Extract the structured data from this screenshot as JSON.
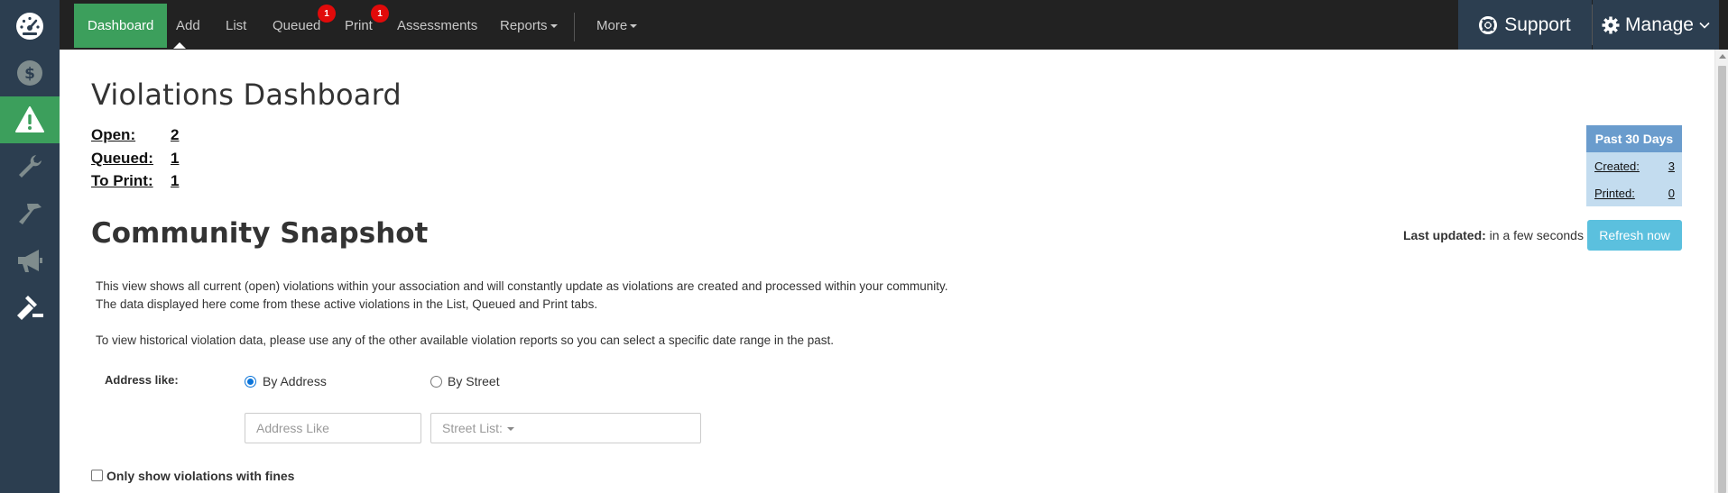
{
  "sidebar": {
    "items": [
      {
        "icon": "speedometer-icon",
        "active": false
      },
      {
        "icon": "dollar-icon",
        "active": false
      },
      {
        "icon": "warning-icon",
        "active": true
      },
      {
        "icon": "wrench-icon",
        "active": false
      },
      {
        "icon": "hammer-icon",
        "active": false
      },
      {
        "icon": "megaphone-icon",
        "active": false
      },
      {
        "icon": "gavel-icon",
        "active": false
      }
    ]
  },
  "topnav": {
    "dashboard": "Dashboard",
    "add": "Add",
    "list": "List",
    "queued": "Queued",
    "queued_badge": "1",
    "print": "Print",
    "print_badge": "1",
    "assessments": "Assessments",
    "reports": "Reports",
    "more": "More",
    "support": "Support",
    "manage": "Manage"
  },
  "page": {
    "title": "Violations Dashboard",
    "counts": [
      {
        "label": "Open:",
        "value": "2"
      },
      {
        "label": "Queued:",
        "value": "1"
      },
      {
        "label": "To Print:",
        "value": "1"
      }
    ],
    "snapshot_title": "Community Snapshot",
    "past_panel": {
      "header": "Past 30 Days",
      "created_label": "Created:",
      "created_value": "3",
      "printed_label": "Printed:",
      "printed_value": "0"
    },
    "last_updated_label": "Last updated:",
    "last_updated_value": "in a few seconds",
    "refresh_label": "Refresh now",
    "description": [
      "This view shows all current (open) violations within your association and will constantly update as violations are created and processed within your community.",
      "The data displayed here come from these active violations in the List, Queued and Print tabs.",
      "To view historical violation data, please use any of the other available violation reports so you can select a specific date range in the past."
    ],
    "address_like_label": "Address like:",
    "by_address_label": "By Address",
    "by_street_label": "By Street",
    "address_placeholder": "Address Like",
    "street_list_label": "Street List:",
    "only_fines_label": "Only show violations with fines"
  },
  "colors": {
    "sidebar_bg": "#2c3e50",
    "accent_green": "#3c9f5c",
    "topbar_bg": "#222222",
    "badge_red": "#e10a0a",
    "panel_header": "#6a9ccd",
    "panel_body": "#c3dcef",
    "refresh_button": "#5bc0de"
  }
}
